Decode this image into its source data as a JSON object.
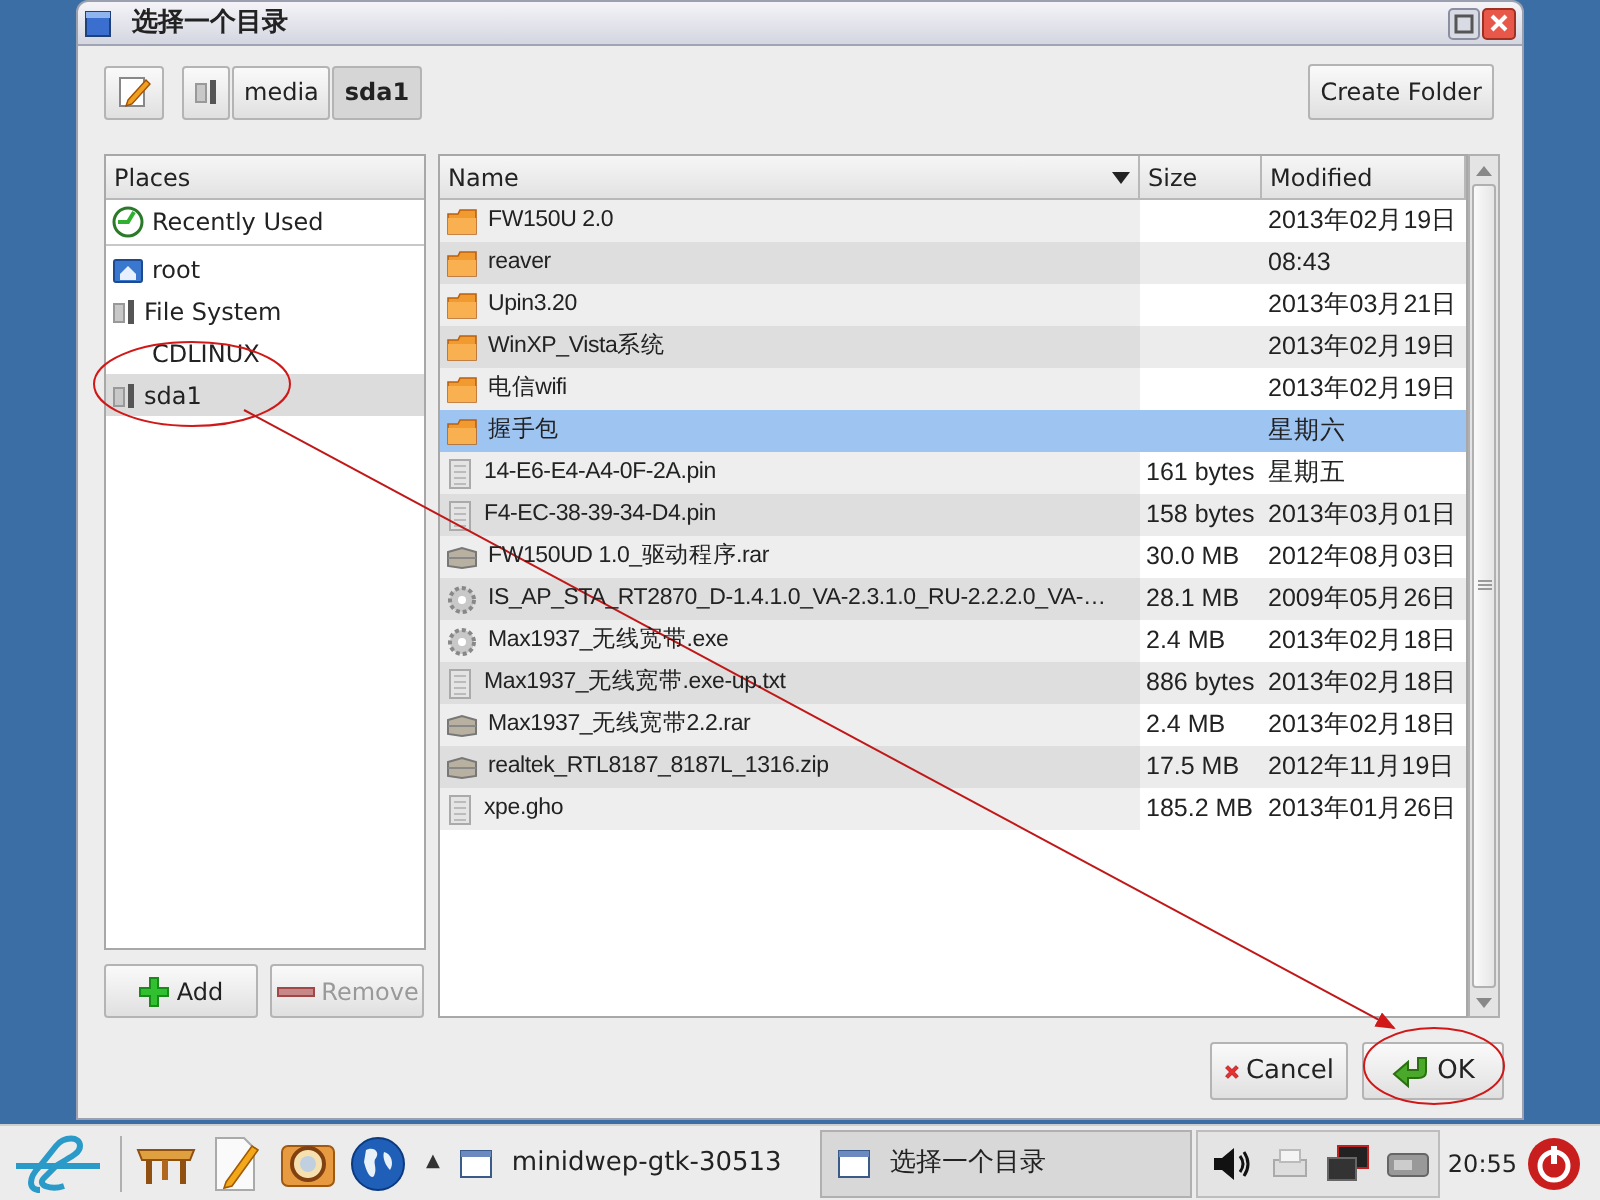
{
  "window": {
    "title": "选择一个目录"
  },
  "path_bar": {
    "buttons": [
      {
        "kind": "drive",
        "selected": false
      },
      {
        "kind": "text",
        "label": "media",
        "selected": false
      },
      {
        "kind": "text",
        "label": "sda1",
        "selected": true
      }
    ],
    "create_folder": "Create Folder"
  },
  "places": {
    "header": "Places",
    "items": [
      {
        "kind": "recent",
        "label": "Recently Used",
        "selected": false,
        "separator_after": true
      },
      {
        "kind": "home",
        "label": "root",
        "selected": false
      },
      {
        "kind": "drive",
        "label": "File System",
        "selected": false
      },
      {
        "kind": "plain",
        "label": "CDLINUX",
        "selected": false
      },
      {
        "kind": "drive",
        "label": "sda1",
        "selected": true
      }
    ],
    "add": {
      "label": "Add",
      "disabled": false
    },
    "remove": {
      "label": "Remove",
      "disabled": true
    }
  },
  "files": {
    "columns": [
      "Name",
      "Size",
      "Modified"
    ],
    "rows": [
      {
        "kind": "folder",
        "name": "FW150U 2.0",
        "modified": "2013年02月19日",
        "selected": false
      },
      {
        "kind": "folder",
        "name": "reaver",
        "modified": "08:43",
        "selected": false
      },
      {
        "kind": "folder",
        "name": "Upin3.20",
        "modified": "2013年03月21日",
        "selected": false
      },
      {
        "kind": "folder",
        "name": "WinXP_Vista系统",
        "modified": "2013年02月19日",
        "selected": false
      },
      {
        "kind": "folder",
        "name": "电信wifi",
        "modified": "2013年02月19日",
        "selected": false
      },
      {
        "kind": "folder",
        "name": "握手包",
        "modified": "星期六",
        "selected": true
      },
      {
        "kind": "file",
        "name": "14-E6-E4-A4-0F-2A.pin",
        "size": "161 bytes",
        "modified": "星期五",
        "selected": false
      },
      {
        "kind": "file",
        "name": "F4-EC-38-39-34-D4.pin",
        "size": "158 bytes",
        "modified": "2013年03月01日",
        "selected": false
      },
      {
        "kind": "archive",
        "name": "FW150UD 1.0_驱动程序.rar",
        "size": "30.0 MB",
        "modified": "2012年08月03日",
        "selected": false
      },
      {
        "kind": "exe",
        "name": "IS_AP_STA_RT2870_D-1.4.1.0_VA-2.3.1.0_RU-2.2.2.0_VA-…",
        "size": "28.1 MB",
        "modified": "2009年05月26日",
        "selected": false
      },
      {
        "kind": "exe",
        "name": "Max1937_无线宽带.exe",
        "size": "2.4 MB",
        "modified": "2013年02月18日",
        "selected": false
      },
      {
        "kind": "file",
        "name": "Max1937_无线宽带.exe-up.txt",
        "size": "886 bytes",
        "modified": "2013年02月18日",
        "selected": false
      },
      {
        "kind": "archive",
        "name": "Max1937_无线宽带2.2.rar",
        "size": "2.4 MB",
        "modified": "2013年02月18日",
        "selected": false
      },
      {
        "kind": "archive",
        "name": "realtek_RTL8187_8187L_1316.zip",
        "size": "17.5 MB",
        "modified": "2012年11月19日",
        "selected": false
      },
      {
        "kind": "file",
        "name": "xpe.gho",
        "size": "185.2 MB",
        "modified": "2013年01月26日",
        "selected": false
      }
    ]
  },
  "buttons": [
    {
      "kind": "cancel",
      "label": "Cancel"
    },
    {
      "kind": "ok",
      "label": "OK"
    }
  ],
  "taskbar": {
    "tray_arrow": "▲",
    "tasks": [
      {
        "label": "minidwep-gtk-30513",
        "selected": false
      },
      {
        "label": "选择一个目录",
        "selected": true
      }
    ],
    "clock": "20:55"
  }
}
